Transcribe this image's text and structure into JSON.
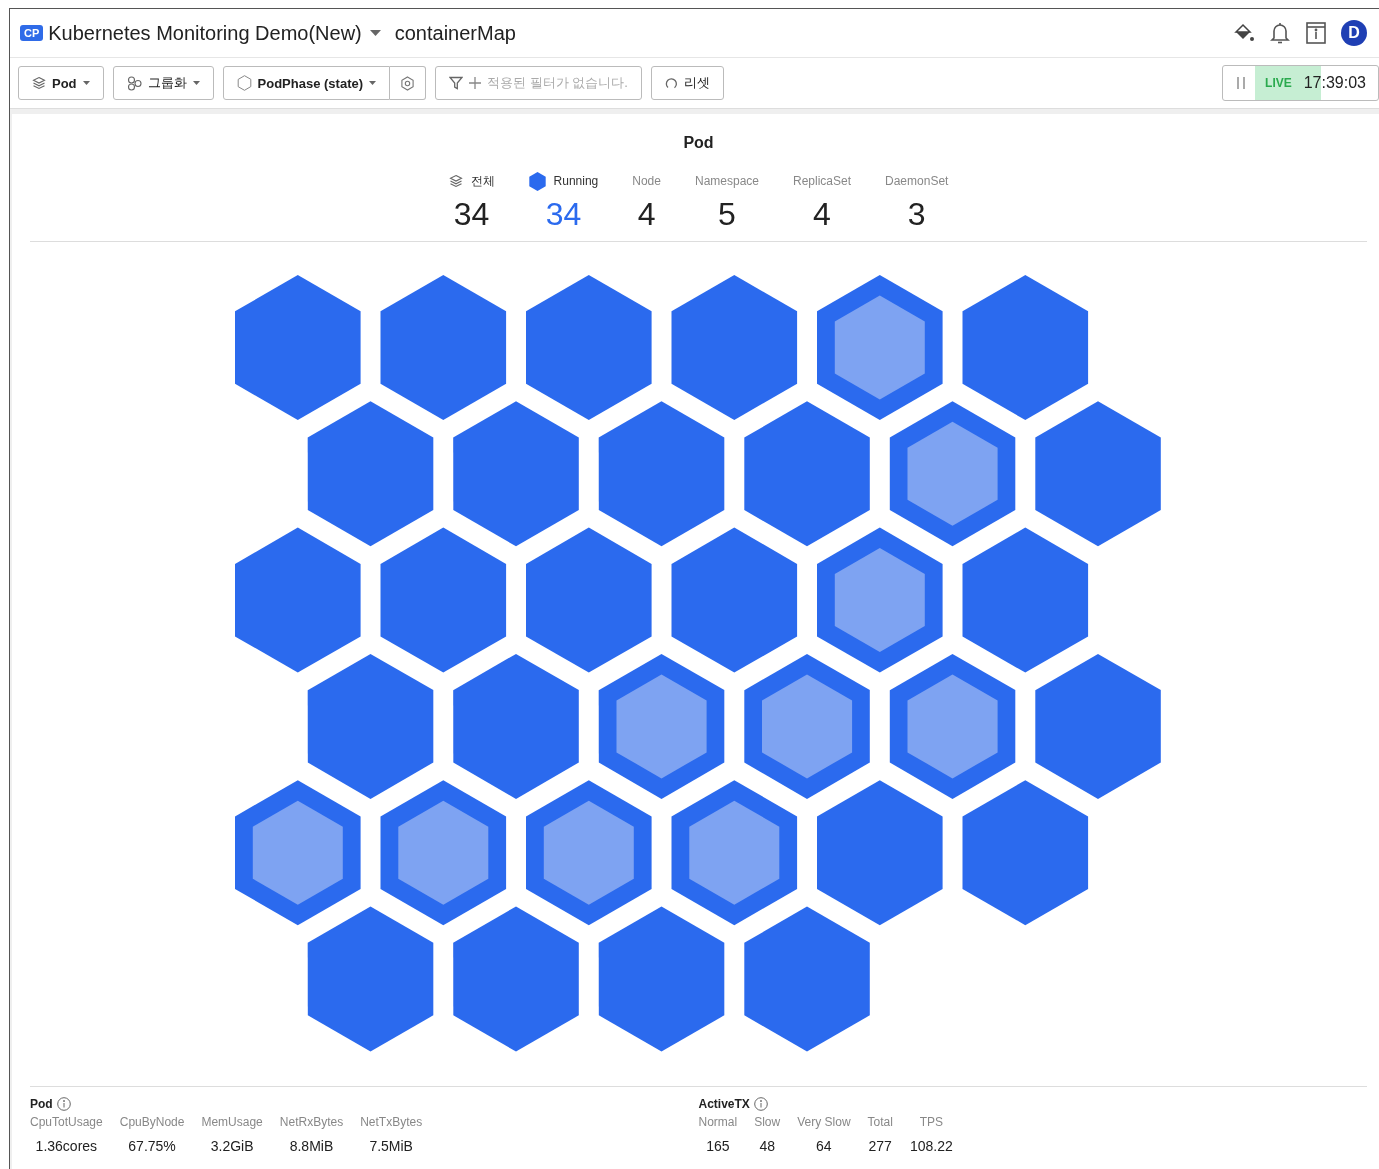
{
  "header": {
    "badge": "CP",
    "title": "Kubernetes Monitoring Demo(New)",
    "page": "containerMap",
    "avatar": "D"
  },
  "toolbar": {
    "buttons": [
      {
        "kind": "layers",
        "label": "Pod"
      },
      {
        "kind": "group",
        "label": "그룹화"
      },
      {
        "kind": "hex",
        "label": "PodPhase (state)"
      }
    ],
    "filter": {
      "placeholder": "적용된 필터가 없습니다."
    },
    "reset": {
      "label": "리셋"
    },
    "live": {
      "label": "LIVE",
      "time": "17:39:03",
      "on": true
    }
  },
  "map": {
    "title": "Pod",
    "stats": [
      {
        "kind": "all",
        "label": "전체",
        "value": "34"
      },
      {
        "kind": "state",
        "label": "Running",
        "value": "34",
        "color": "#2b6aee"
      },
      {
        "kind": "plain",
        "label": "Node",
        "value": "4"
      },
      {
        "kind": "plain",
        "label": "Namespace",
        "value": "5"
      },
      {
        "kind": "plain",
        "label": "ReplicaSet",
        "value": "4"
      },
      {
        "kind": "plain",
        "label": "DaemonSet",
        "value": "3"
      }
    ],
    "rows": [
      [
        false,
        false,
        false,
        false,
        true,
        false
      ],
      [
        false,
        false,
        false,
        false,
        true,
        false
      ],
      [
        false,
        false,
        false,
        false,
        true,
        false
      ],
      [
        false,
        false,
        true,
        true,
        true,
        false
      ],
      [
        true,
        true,
        true,
        true,
        false,
        false
      ],
      [
        false,
        false,
        false,
        false
      ]
    ]
  },
  "metrics": [
    {
      "title": "Pod",
      "items": [
        {
          "label": "CpuTotUsage",
          "value": "1.36cores"
        },
        {
          "label": "CpuByNode",
          "value": "67.75%"
        },
        {
          "label": "MemUsage",
          "value": "3.2GiB"
        },
        {
          "label": "NetRxBytes",
          "value": "8.8MiB"
        },
        {
          "label": "NetTxBytes",
          "value": "7.5MiB"
        }
      ]
    },
    {
      "title": "ActiveTX",
      "items": [
        {
          "label": "Normal",
          "value": "165"
        },
        {
          "label": "Slow",
          "value": "48"
        },
        {
          "label": "Very Slow",
          "value": "64"
        },
        {
          "label": "Total",
          "value": "277"
        },
        {
          "label": "TPS",
          "value": "108.22"
        }
      ]
    }
  ]
}
